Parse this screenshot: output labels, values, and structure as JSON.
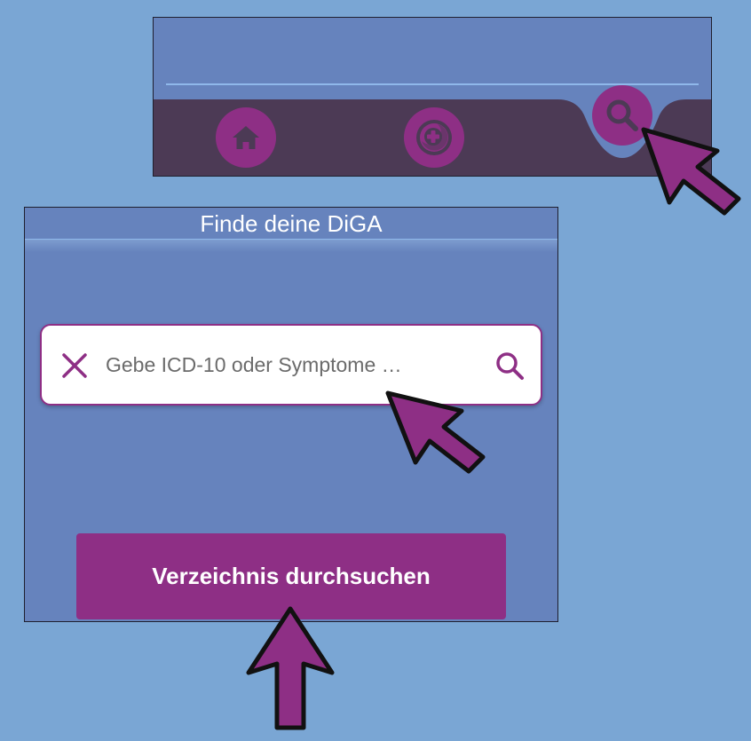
{
  "nav_bar": {
    "items": [
      {
        "id": "home",
        "icon": "home-icon"
      },
      {
        "id": "diga",
        "icon": "diga-icon"
      },
      {
        "id": "search",
        "icon": "search-icon",
        "active": true
      }
    ]
  },
  "search_screen": {
    "title": "Finde deine DiGA",
    "search": {
      "value": "",
      "placeholder": "Gebe ICD-10 oder Symptome …",
      "clear_icon": "close-icon",
      "submit_icon": "search-icon"
    },
    "directory_button_label": "Verzeichnis durchsuchen"
  },
  "colors": {
    "page_background": "#7aa6d4",
    "panel_background": "#6683bd",
    "nav_bar": "#4c3a55",
    "accent": "#8e2f85",
    "divider": "#8fb8ea",
    "arrow_outline": "#111111"
  },
  "annotations": [
    {
      "icon": "pointer-arrow-icon",
      "target": "nav-search-button"
    },
    {
      "icon": "pointer-arrow-icon",
      "target": "search-input"
    },
    {
      "icon": "pointer-arrow-icon",
      "target": "directory-button"
    }
  ]
}
